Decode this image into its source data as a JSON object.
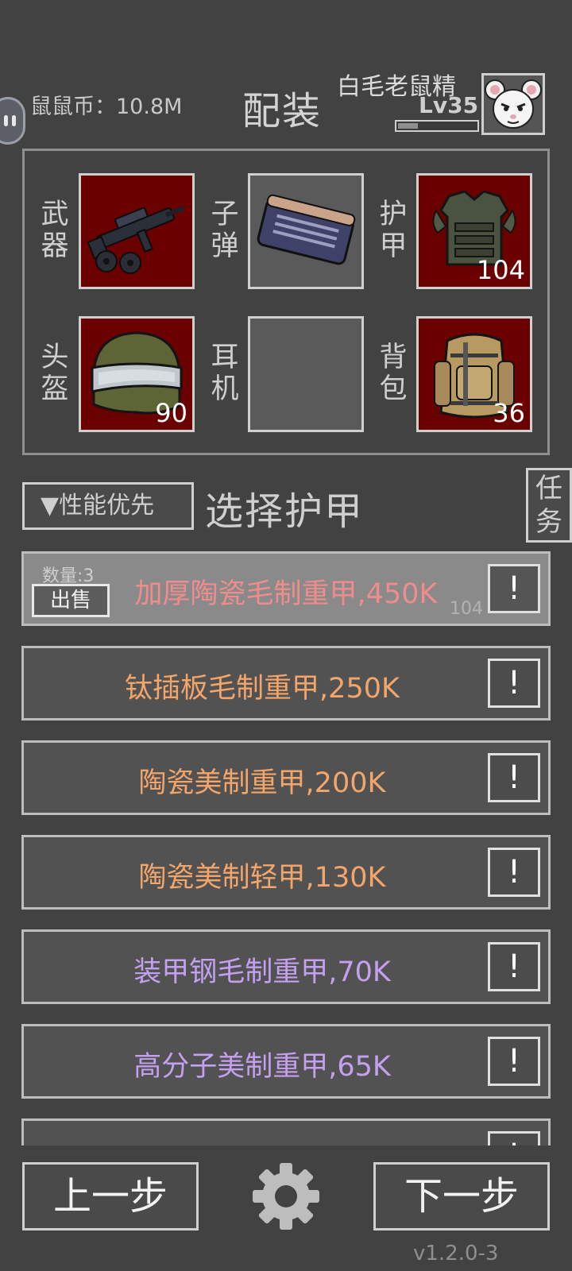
{
  "header": {
    "coin_label": "鼠鼠币：10.8M",
    "title": "配装",
    "player_name": "白毛老鼠精",
    "player_level": "Lv35",
    "xp_progress": 0.25,
    "avatar_icon": "white-mouse-avatar-icon"
  },
  "slots": [
    {
      "label": "武器",
      "icon": "gun-icon",
      "filled": true,
      "count": ""
    },
    {
      "label": "子弹",
      "icon": "ammo-icon",
      "filled": false,
      "count": ""
    },
    {
      "label": "护甲",
      "icon": "body-armor-icon",
      "filled": true,
      "count": "104"
    },
    {
      "label": "头盔",
      "icon": "helmet-icon",
      "filled": true,
      "count": "90"
    },
    {
      "label": "耳机",
      "icon": "",
      "filled": false,
      "count": ""
    },
    {
      "label": "背包",
      "icon": "backpack-icon",
      "filled": true,
      "count": "36"
    }
  ],
  "selector": {
    "sort_label": "▼性能优先",
    "section_title": "选择护甲",
    "task_label": "任务"
  },
  "armor_list": [
    {
      "name": "加厚陶瓷毛制重甲,450K",
      "color": "#f08c8c",
      "selected": true,
      "quantity": "数量:3",
      "sell": "出售",
      "level": "104"
    },
    {
      "name": "钛插板毛制重甲,250K",
      "color": "#f4a56a",
      "selected": false
    },
    {
      "name": "陶瓷美制重甲,200K",
      "color": "#f4a56a",
      "selected": false
    },
    {
      "name": "陶瓷美制轻甲,130K",
      "color": "#f4a56a",
      "selected": false
    },
    {
      "name": "装甲钢毛制重甲,70K",
      "color": "#c4a0f0",
      "selected": false
    },
    {
      "name": "高分子美制重甲,65K",
      "color": "#c4a0f0",
      "selected": false
    },
    {
      "name": "",
      "color": "#c4a0f0",
      "selected": false
    }
  ],
  "info_label": "!",
  "footer": {
    "prev_label": "上一步",
    "next_label": "下一步",
    "settings_icon": "gear-icon",
    "version": "v1.2.0-3"
  }
}
